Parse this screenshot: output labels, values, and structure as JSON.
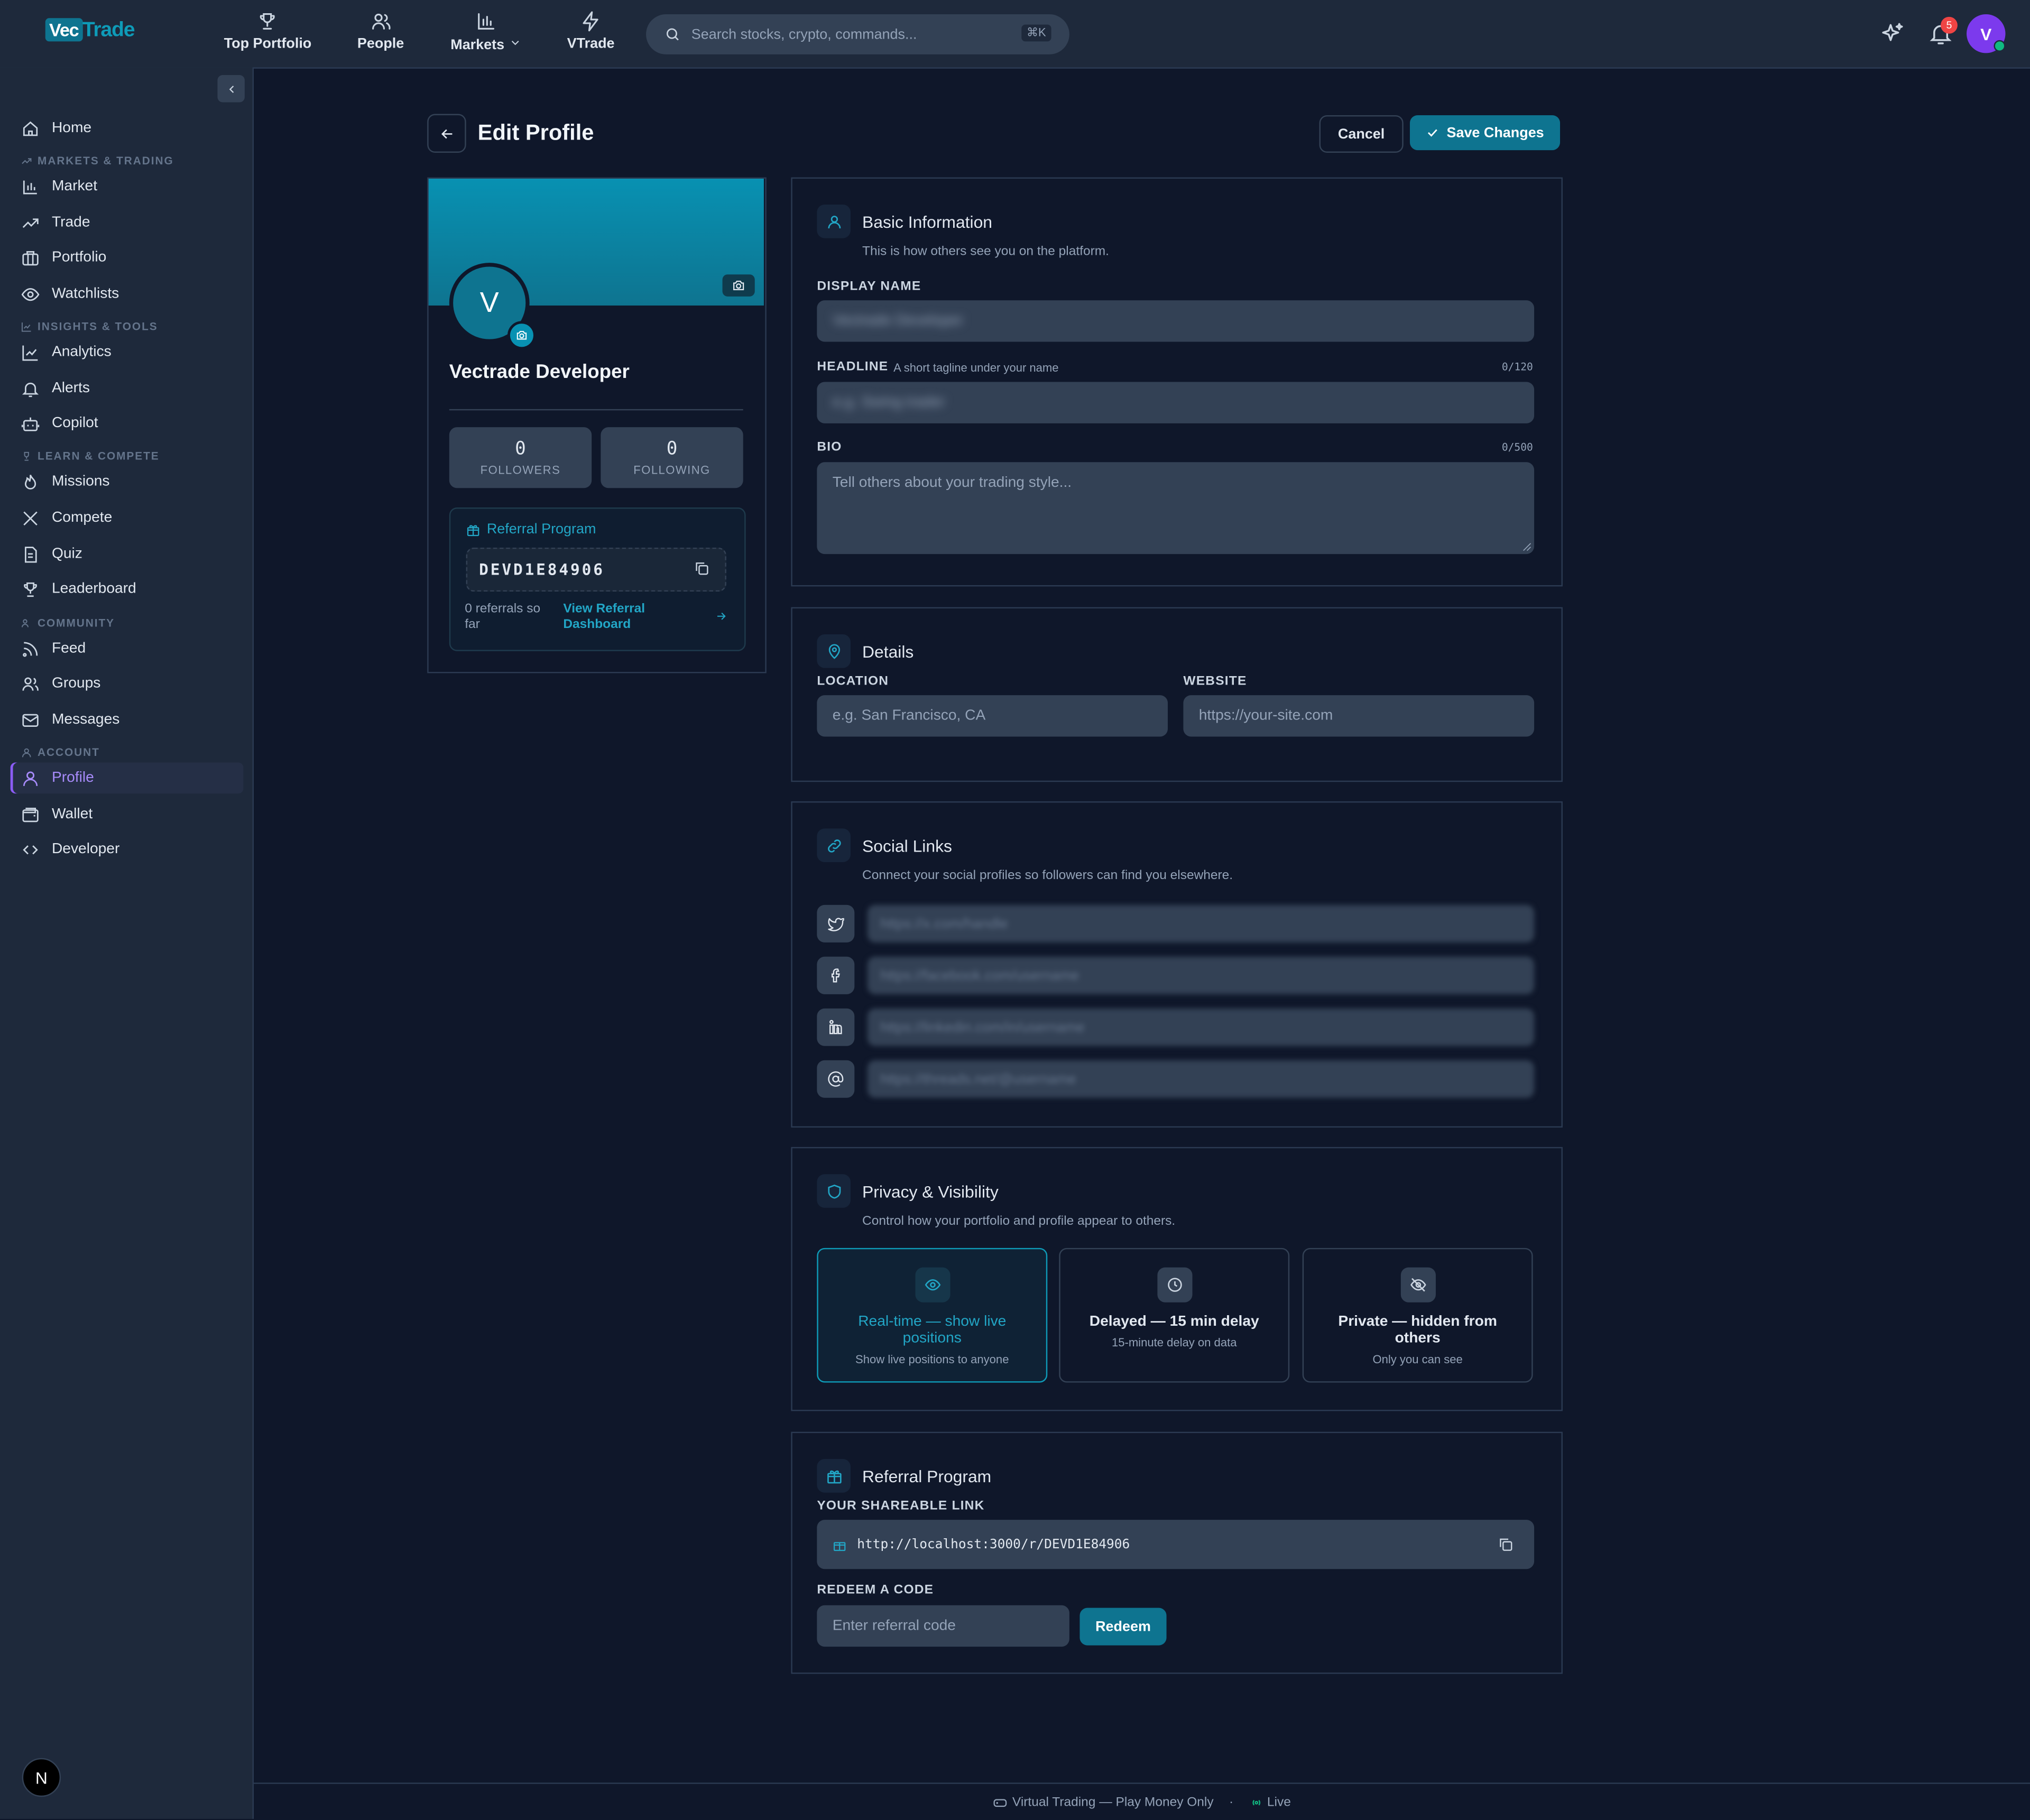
{
  "brand": {
    "vec": "Vec",
    "trade": "Trade"
  },
  "nav": {
    "items": [
      {
        "label": "Top Portfolio",
        "icon": "trophy-icon"
      },
      {
        "label": "People",
        "icon": "users-icon"
      },
      {
        "label": "Markets",
        "icon": "bar-chart-icon"
      },
      {
        "label": "VTrade",
        "icon": "bolt-icon"
      }
    ],
    "search_placeholder": "Search stocks, crypto, commands...",
    "search_shortcut": "⌘K",
    "notification_count": "5",
    "avatar_letter": "V"
  },
  "sidebar": {
    "home": "Home",
    "sections": {
      "markets": "MARKETS & TRADING",
      "insights": "INSIGHTS & TOOLS",
      "learn": "LEARN & COMPETE",
      "community": "COMMUNITY",
      "account": "ACCOUNT"
    },
    "items": {
      "market": "Market",
      "trade": "Trade",
      "portfolio": "Portfolio",
      "watchlists": "Watchlists",
      "analytics": "Analytics",
      "alerts": "Alerts",
      "copilot": "Copilot",
      "missions": "Missions",
      "compete": "Compete",
      "quiz": "Quiz",
      "leaderboard": "Leaderboard",
      "feed": "Feed",
      "groups": "Groups",
      "messages": "Messages",
      "profile": "Profile",
      "wallet": "Wallet",
      "developer": "Developer"
    },
    "active": "Profile",
    "bottom_badge": "N"
  },
  "page": {
    "title": "Edit Profile",
    "cancel": "Cancel",
    "save": "Save Changes"
  },
  "profile_card": {
    "avatar_letter": "V",
    "name": "Vectrade Developer",
    "followers_count": "0",
    "followers_label": "FOLLOWERS",
    "following_count": "0",
    "following_label": "FOLLOWING",
    "referral_title": "Referral Program",
    "referral_code": "DEVD1E84906",
    "referrals_text": "0 referrals so far",
    "dashboard_link": "View Referral Dashboard"
  },
  "basic": {
    "title": "Basic Information",
    "subtitle": "This is how others see you on the platform.",
    "display_name_label": "DISPLAY NAME",
    "display_name_value": "Vectrade Developer",
    "headline_label": "HEADLINE",
    "headline_hint": "A short tagline under your name",
    "headline_counter": "0/120",
    "headline_placeholder": "e.g. Swing trader",
    "bio_label": "BIO",
    "bio_counter": "0/500",
    "bio_placeholder": "Tell others about your trading style..."
  },
  "details": {
    "title": "Details",
    "location_label": "LOCATION",
    "location_placeholder": "e.g. San Francisco, CA",
    "website_label": "WEBSITE",
    "website_placeholder": "https://your-site.com"
  },
  "social": {
    "title": "Social Links",
    "subtitle": "Connect your social profiles so followers can find you elsewhere.",
    "links": [
      {
        "icon": "twitter-icon",
        "placeholder": "https://x.com/handle"
      },
      {
        "icon": "facebook-icon",
        "placeholder": "https://facebook.com/username"
      },
      {
        "icon": "linkedin-icon",
        "placeholder": "https://linkedin.com/in/username"
      },
      {
        "icon": "at-icon",
        "placeholder": "https://threads.net/@username"
      }
    ]
  },
  "privacy": {
    "title": "Privacy & Visibility",
    "subtitle": "Control how your portfolio and profile appear to others.",
    "options": [
      {
        "title": "Real-time — show live positions",
        "desc": "Show live positions to anyone",
        "icon": "eye-icon"
      },
      {
        "title": "Delayed — 15 min delay",
        "desc": "15-minute delay on data",
        "icon": "clock-icon"
      },
      {
        "title": "Private — hidden from others",
        "desc": "Only you can see",
        "icon": "eye-off-icon"
      }
    ],
    "selected_index": 0
  },
  "referral": {
    "title": "Referral Program",
    "link_label": "YOUR SHAREABLE LINK",
    "link": "http://localhost:3000/r/DEVD1E84906",
    "redeem_label": "REDEEM A CODE",
    "redeem_placeholder": "Enter referral code",
    "redeem_button": "Redeem"
  },
  "footer": {
    "text": "Virtual Trading — Play Money Only",
    "separator": "·",
    "status": "Live"
  },
  "colors": {
    "background": "#0f172a",
    "panel": "#1e293b",
    "accent": "#0e7490",
    "accent_text": "#22a6c6",
    "active_nav": "#a78bfa",
    "badge": "#ef4444"
  }
}
